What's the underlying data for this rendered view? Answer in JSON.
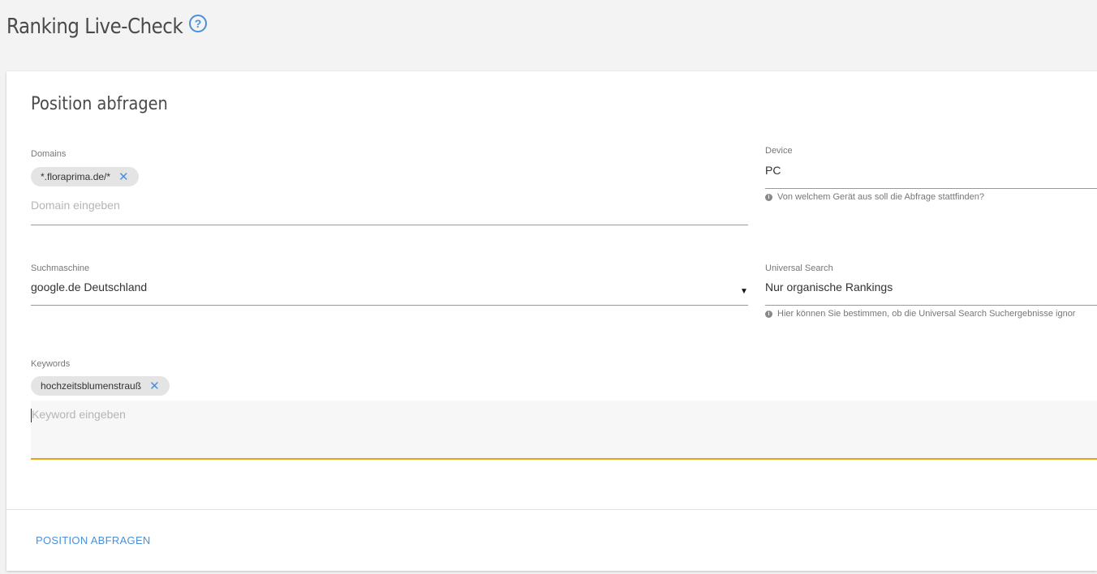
{
  "header": {
    "title": "Ranking Live-Check",
    "help_icon": "?"
  },
  "card": {
    "title": "Position abfragen",
    "domains": {
      "label": "Domains",
      "chips": [
        "*.floraprima.de/*"
      ],
      "chip_remove": "✕",
      "placeholder": "Domain eingeben"
    },
    "device": {
      "label": "Device",
      "value": "PC",
      "hint": "Von welchem Gerät aus soll die Abfrage stattfinden?"
    },
    "search_engine": {
      "label": "Suchmaschine",
      "value": "google.de Deutschland",
      "arrow": "▼"
    },
    "universal_search": {
      "label": "Universal Search",
      "value": "Nur organische Rankings",
      "hint": "Hier können Sie bestimmen, ob die Universal Search Suchergebnisse ignor"
    },
    "keywords": {
      "label": "Keywords",
      "chips": [
        "hochzeitsblumenstrauß"
      ],
      "chip_remove": "✕",
      "placeholder": "Keyword eingeben"
    },
    "submit_label": "POSITION ABFRAGEN"
  },
  "colors": {
    "accent": "#4a90d9",
    "focus_underline": "#e8a317"
  },
  "icons": {
    "help": "help-circle-icon",
    "remove": "close-icon",
    "info": "info-icon",
    "dropdown": "triangle-down-icon"
  }
}
